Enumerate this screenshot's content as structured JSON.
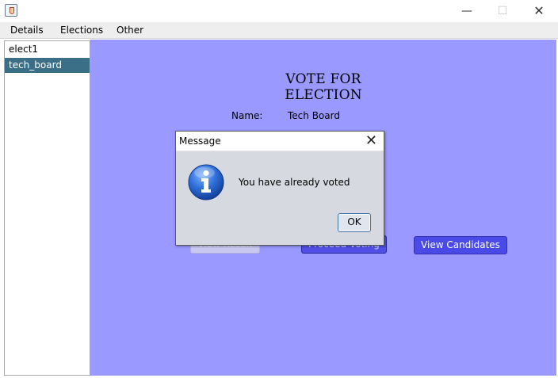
{
  "window": {
    "app_icon": "java-cup-icon",
    "controls": {
      "minimize": "—",
      "maximize": "☐",
      "close": "✕"
    }
  },
  "menubar": {
    "items": [
      "Details",
      "Elections",
      "Other"
    ]
  },
  "elections_list": {
    "items": [
      "elect1",
      "tech_board"
    ],
    "selected": "tech_board"
  },
  "main": {
    "heading": "VOTE FOR ELECTION",
    "name_label": "Name:",
    "name_value": "Tech Board",
    "buttons": {
      "view_result": "View Result",
      "proceed_voting": "Proceed Voting",
      "view_candidates": "View Candidates"
    }
  },
  "dialog": {
    "title": "Message",
    "close": "✕",
    "icon": "info-icon",
    "message": "You have already voted",
    "ok": "OK"
  },
  "colors": {
    "panel": "#9999ff",
    "selection": "#3b6e87",
    "primary_button": "#4a4ae8",
    "dialog_bg": "#d6d9df"
  }
}
